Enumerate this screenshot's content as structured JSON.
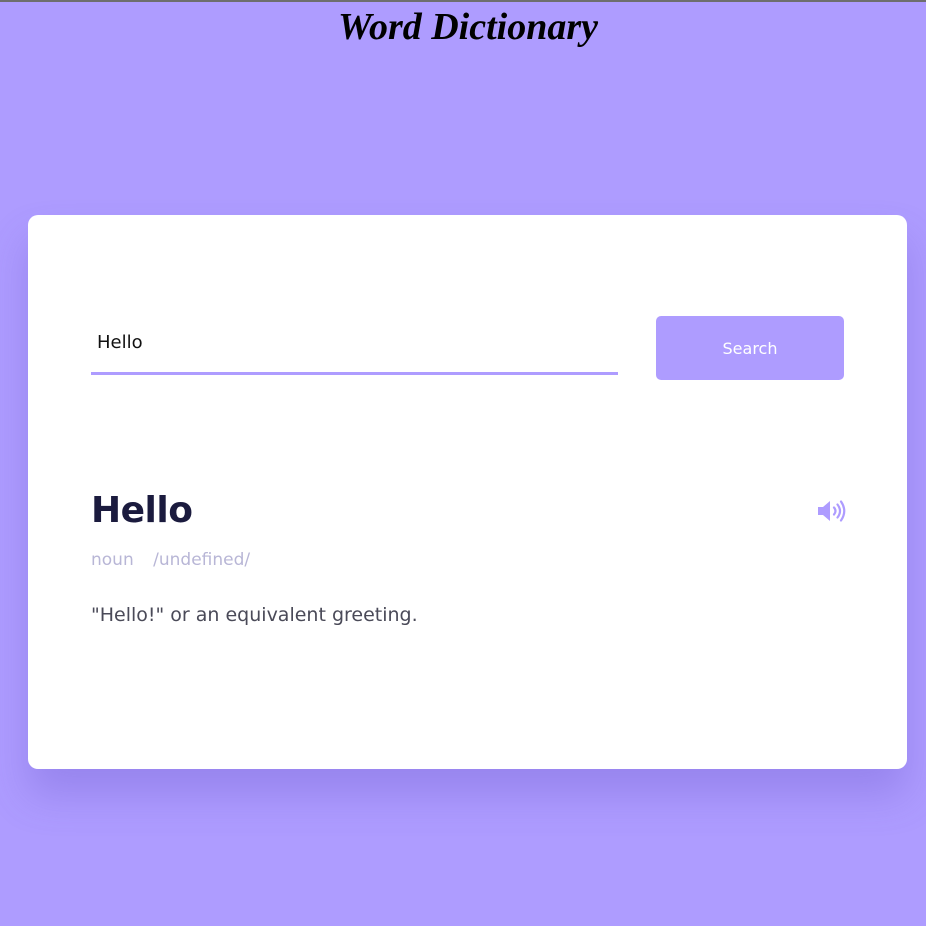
{
  "page": {
    "title": "Word Dictionary"
  },
  "colors": {
    "background": "#ae9cff",
    "card": "#ffffff",
    "accent": "#ae9cff",
    "word": "#1b1b3e",
    "muted": "#b8b6d6",
    "definition": "#4a4a58"
  },
  "search": {
    "value": "Hello",
    "button_label": "Search"
  },
  "result": {
    "word": "Hello",
    "part_of_speech": "noun",
    "phonetic": "/undefined/",
    "definition": "\"Hello!\" or an equivalent greeting.",
    "audio_icon": "speaker-icon"
  }
}
